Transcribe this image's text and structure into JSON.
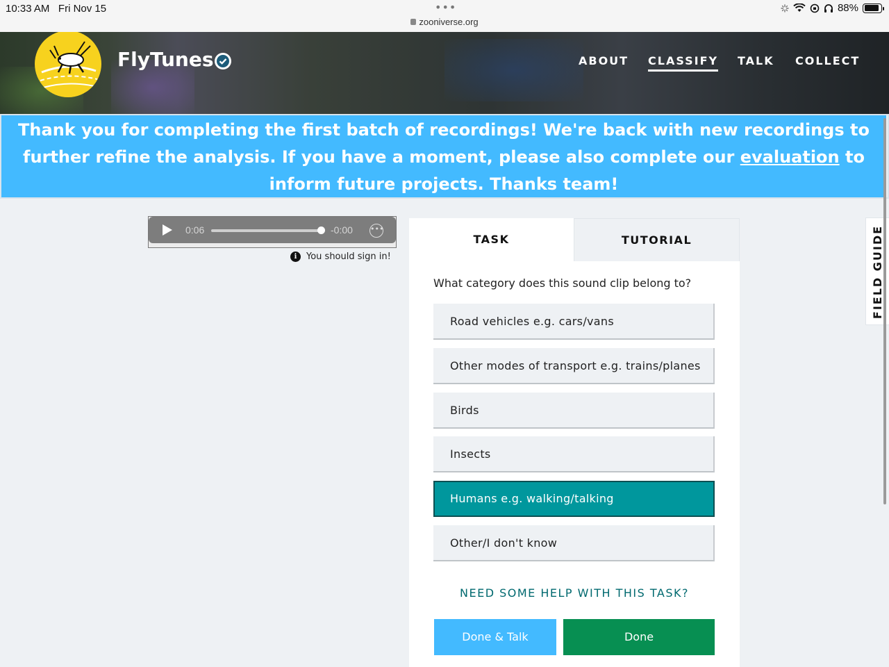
{
  "status_bar": {
    "time": "10:33 AM",
    "date": "Fri Nov 15",
    "url": "zooniverse.org",
    "battery": "88%",
    "battery_level": 0.88
  },
  "header": {
    "project_title": "FlyTunes",
    "nav": [
      "ABOUT",
      "CLASSIFY",
      "TALK",
      "COLLECT"
    ],
    "active_nav": "CLASSIFY"
  },
  "banner": {
    "text_before": "Thank you for completing the first batch of recordings! We're back with new recordings to further refine the analysis. If you have a moment, please also complete our ",
    "link": "evaluation",
    "text_after": " to inform future projects. Thanks team!"
  },
  "player": {
    "elapsed": "0:06",
    "remaining": "-0:00",
    "progress": 1.0
  },
  "signin_notice": "You should sign in!",
  "task": {
    "tabs": [
      "TASK",
      "TUTORIAL"
    ],
    "question": "What category does this sound clip belong to?",
    "answers": [
      "Road vehicles e.g. cars/vans",
      "Other modes of transport e.g. trains/planes",
      "Birds",
      "Insects",
      "Humans e.g. walking/talking",
      "Other/I don't know"
    ],
    "selected_index": 4,
    "help": "NEED SOME HELP WITH THIS TASK?",
    "done_talk": "Done & Talk",
    "done": "Done"
  },
  "field_guide": "FIELD GUIDE",
  "colors": {
    "banner": "#43baff",
    "selected_answer": "#00979d",
    "done_button": "#078f52",
    "help_link": "#00696f",
    "logo": "#f7d21e"
  }
}
